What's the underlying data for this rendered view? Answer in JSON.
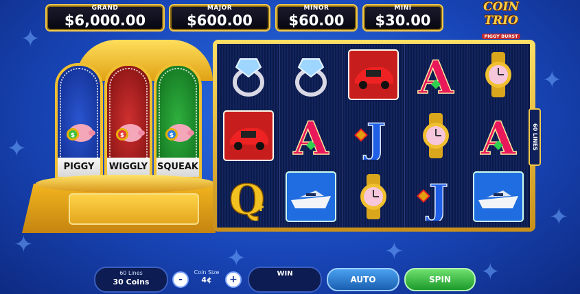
{
  "jackpots": [
    {
      "title": "GRAND",
      "value": "$6,000.00"
    },
    {
      "title": "MAJOR",
      "value": "$600.00"
    },
    {
      "title": "MINOR",
      "value": "$60.00"
    },
    {
      "title": "MINI",
      "value": "$30.00"
    }
  ],
  "logo": {
    "main": "COIN TRIO",
    "sub": "PIGGY BURST"
  },
  "pigs": [
    {
      "label": "PIGGY",
      "color": "#1a3fb0"
    },
    {
      "label": "WIGGLY",
      "color": "#b01a1a"
    },
    {
      "label": "SQUEAK",
      "color": "#1a8a2a"
    }
  ],
  "reels": [
    [
      "ring",
      "car",
      "Q"
    ],
    [
      "ring",
      "A",
      "boat"
    ],
    [
      "car",
      "J",
      "watch"
    ],
    [
      "A",
      "watch",
      "J"
    ],
    [
      "watch",
      "A",
      "boat"
    ]
  ],
  "side_tag": "60 LINES",
  "controls": {
    "lines_label": "60 Lines",
    "coins_value": "30 Coins",
    "coin_size_label": "Coin Size",
    "coin_size_value": "4¢",
    "minus": "-",
    "plus": "+",
    "win_label": "WIN",
    "auto_label": "AUTO",
    "spin_label": "SPIN"
  },
  "colors": {
    "accent_gold": "#f2c94c",
    "spin_green": "#3bb53b",
    "auto_blue": "#2b78c9"
  }
}
